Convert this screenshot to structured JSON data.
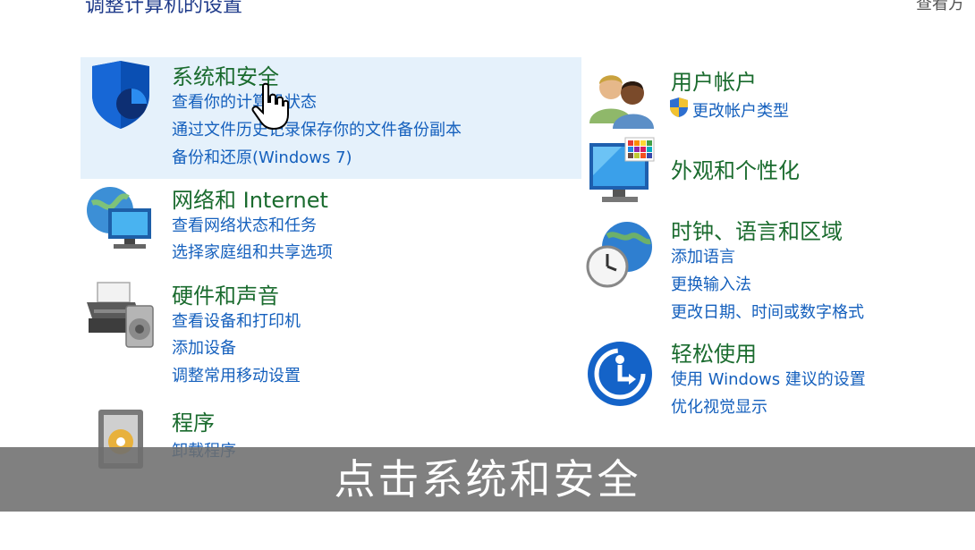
{
  "header": {
    "title": "调整计算机的设置",
    "view_by": "查看方"
  },
  "categories": {
    "system_security": {
      "title": "系统和安全",
      "links": [
        "查看你的计算机状态",
        "通过文件历史记录保存你的文件备份副本",
        "备份和还原(Windows 7)"
      ]
    },
    "network": {
      "title": "网络和 Internet",
      "links": [
        "查看网络状态和任务",
        "选择家庭组和共享选项"
      ]
    },
    "hardware": {
      "title": "硬件和声音",
      "links": [
        "查看设备和打印机",
        "添加设备",
        "调整常用移动设置"
      ]
    },
    "programs": {
      "title": "程序",
      "links": [
        "卸载程序"
      ]
    },
    "user_accounts": {
      "title": "用户帐户",
      "links": [
        "更改帐户类型"
      ]
    },
    "appearance": {
      "title": "外观和个性化",
      "links": []
    },
    "clock_region": {
      "title": "时钟、语言和区域",
      "links": [
        "添加语言",
        "更换输入法",
        "更改日期、时间或数字格式"
      ]
    },
    "ease_access": {
      "title": "轻松使用",
      "links": [
        "使用 Windows 建议的设置",
        "优化视觉显示"
      ]
    }
  },
  "caption": {
    "text": "点击系统和安全"
  },
  "colors": {
    "category_title": "#1a6b2e",
    "link": "#1560bd",
    "highlight": "#e5f1fb",
    "caption_bar": "#6e6e6e"
  },
  "icons": {
    "system_security": "shield-icon",
    "network": "network-globe-icon",
    "hardware": "printer-icon",
    "programs": "programs-icon",
    "user_accounts": "users-icon",
    "appearance": "monitor-palette-icon",
    "clock_region": "clock-globe-icon",
    "ease_access": "ease-of-access-icon",
    "uac": "uac-shield-icon",
    "cursor": "hand-cursor-icon"
  }
}
